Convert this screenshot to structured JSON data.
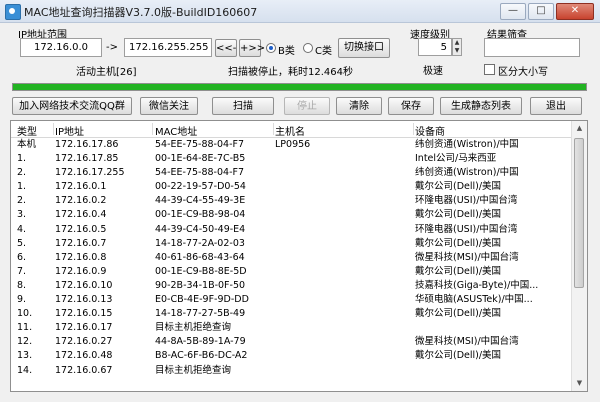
{
  "window": {
    "title": "MAC地址查询扫描器V3.7.0版-BuildID160607",
    "min": "—",
    "max": "□",
    "close": "✕"
  },
  "ip_range": {
    "label": "IP地址范围",
    "start": "172.16.0.0",
    "arrow": "->",
    "end": "172.16.255.255",
    "prev_btn": "<<-",
    "next_btn": "+>>",
    "class_b": "B类",
    "class_c": "C类",
    "switch_btn": "切换接口",
    "active_hosts": "活动主机[26]",
    "scan_status": "扫描被停止，耗时12.464秒"
  },
  "speed": {
    "label": "速度级别",
    "value": "5",
    "caption": "极速"
  },
  "filter": {
    "label": "结果筛查",
    "value": "",
    "case_label": "区分大小写"
  },
  "progress": {
    "percent": 100
  },
  "toolbar": {
    "join_group": "加入网络技术交流QQ群",
    "follow": "微信关注",
    "scan": "扫描",
    "stop": "停止",
    "clear": "清除",
    "save": "保存",
    "gen_static": "生成静态列表",
    "exit": "退出"
  },
  "table": {
    "columns": [
      "类型",
      "IP地址",
      "MAC地址",
      "主机名",
      "设备商"
    ],
    "rows": [
      [
        "本机",
        "172.16.17.86",
        "54-EE-75-88-04-F7",
        "LP0956",
        "纬创资通(Wistron)/中国"
      ],
      [
        "1.",
        "172.16.17.85",
        "00-1E-64-8E-7C-B5",
        "",
        "Intel公司/马来西亚"
      ],
      [
        "2.",
        "172.16.17.255",
        "54-EE-75-88-04-F7",
        "",
        "纬创资通(Wistron)/中国"
      ],
      [
        "1.",
        "172.16.0.1",
        "00-22-19-57-D0-54",
        "",
        "戴尔公司(Dell)/美国"
      ],
      [
        "2.",
        "172.16.0.2",
        "44-39-C4-55-49-3E",
        "",
        "环隆电器(USI)/中国台湾"
      ],
      [
        "3.",
        "172.16.0.4",
        "00-1E-C9-B8-98-04",
        "",
        "戴尔公司(Dell)/美国"
      ],
      [
        "4.",
        "172.16.0.5",
        "44-39-C4-50-49-E4",
        "",
        "环隆电器(USI)/中国台湾"
      ],
      [
        "5.",
        "172.16.0.7",
        "14-18-77-2A-02-03",
        "",
        "戴尔公司(Dell)/美国"
      ],
      [
        "6.",
        "172.16.0.8",
        "40-61-86-68-43-64",
        "",
        "微星科技(MSI)/中国台湾"
      ],
      [
        "7.",
        "172.16.0.9",
        "00-1E-C9-B8-8E-5D",
        "",
        "戴尔公司(Dell)/美国"
      ],
      [
        "8.",
        "172.16.0.10",
        "90-2B-34-1B-0F-50",
        "",
        "技嘉科技(Giga-Byte)/中国..."
      ],
      [
        "9.",
        "172.16.0.13",
        "E0-CB-4E-9F-9D-DD",
        "",
        "华硕电脑(ASUSTek)/中国..."
      ],
      [
        "10.",
        "172.16.0.15",
        "14-18-77-27-5B-49",
        "",
        "戴尔公司(Dell)/美国"
      ],
      [
        "11.",
        "172.16.0.17",
        "目标主机拒绝查询",
        "",
        ""
      ],
      [
        "12.",
        "172.16.0.27",
        "44-8A-5B-89-1A-79",
        "",
        "微星科技(MSI)/中国台湾"
      ],
      [
        "13.",
        "172.16.0.48",
        "B8-AC-6F-B6-DC-A2",
        "",
        "戴尔公司(Dell)/美国"
      ],
      [
        "14.",
        "172.16.0.67",
        "目标主机拒绝查询",
        "",
        ""
      ]
    ]
  },
  "colors": {
    "progress": "#22b322",
    "window_bg": "#f0f0f0"
  },
  "icons": {
    "app": "app-icon",
    "scroll_up": "chevron-up-icon",
    "scroll_down": "chevron-down-icon"
  }
}
